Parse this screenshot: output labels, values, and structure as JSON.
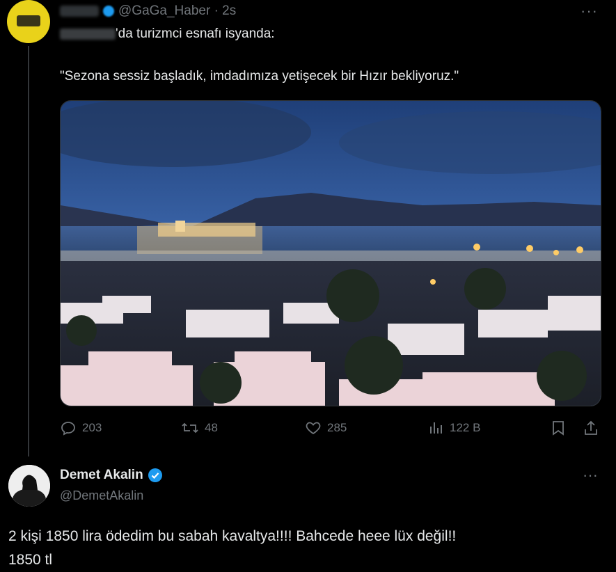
{
  "quoted_tweet": {
    "handle": "@GaGa_Haber",
    "time": "· 2s",
    "line1_suffix": "'da turizmci esnafı isyanda:",
    "quote": "\"Sezona sessiz başladık, imdadımıza yetişecek bir Hızır bekliyoruz.\"",
    "image_alt": "Bodrum harbor at dusk"
  },
  "actions": {
    "replies": "203",
    "reposts": "48",
    "likes": "285",
    "views": "122 B"
  },
  "reply_tweet": {
    "name": "Demet Akalin",
    "handle": "@DemetAkalin",
    "text_line1": "2 kişi 1850 lira ödedim bu sabah kavaltya!!!! Bahcede heee lüx değil!!",
    "text_line2": "1850 tl"
  },
  "icons": [
    "more-icon",
    "reply-icon",
    "repost-icon",
    "like-icon",
    "views-icon",
    "bookmark-icon",
    "share-icon",
    "verified-icon"
  ],
  "colors": {
    "background": "#000000",
    "text": "#e7e9ea",
    "muted": "#71767b",
    "verified": "#1d9bf0"
  }
}
